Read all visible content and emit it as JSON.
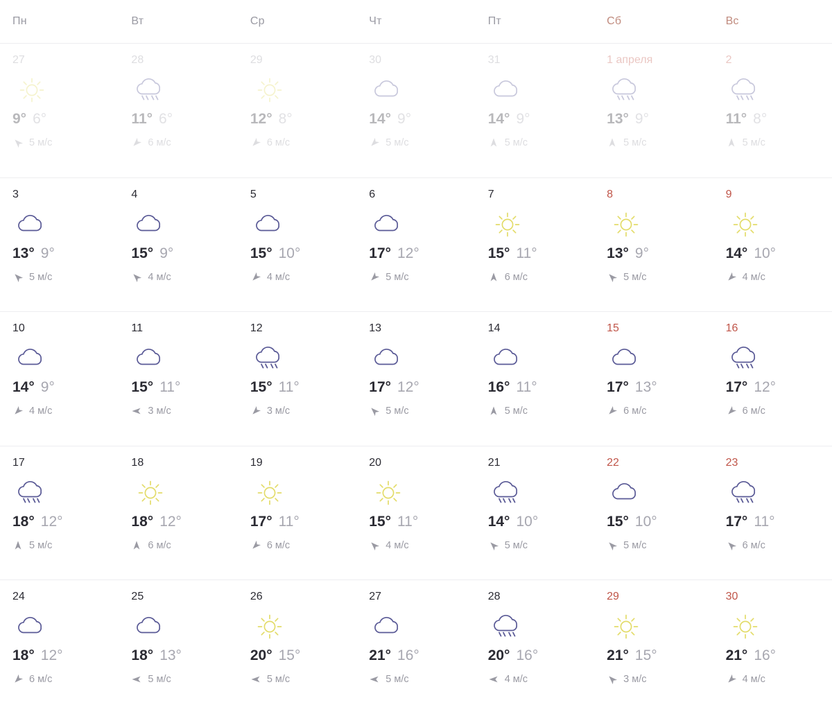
{
  "colors": {
    "sun": "#e3dc6a",
    "cloud": "#5a5a96",
    "rain": "#5a5a96",
    "weekend_header": "#c08b7e",
    "weekend_number": "#c0564a",
    "day_temp": "#2b2b33",
    "night_temp": "#a7a7b0",
    "wind": "#9a9aa3",
    "grid_line": "#ededf0",
    "background": "#ffffff"
  },
  "wind_unit": "м/с",
  "degree": "°",
  "weekdays": [
    {
      "label": "Пн",
      "weekend": false
    },
    {
      "label": "Вт",
      "weekend": false
    },
    {
      "label": "Ср",
      "weekend": false
    },
    {
      "label": "Чт",
      "weekend": false
    },
    {
      "label": "Пт",
      "weekend": false
    },
    {
      "label": "Сб",
      "weekend": true
    },
    {
      "label": "Вс",
      "weekend": true
    }
  ],
  "weeks": [
    {
      "past": true,
      "days": [
        {
          "date": "27",
          "weekend": false,
          "icon": "sun",
          "day_temp": "9°",
          "night_temp": "6°",
          "wind_dir": "nw",
          "wind_speed": "5 м/с"
        },
        {
          "date": "28",
          "weekend": false,
          "icon": "rain",
          "day_temp": "11°",
          "night_temp": "6°",
          "wind_dir": "sw",
          "wind_speed": "6 м/с"
        },
        {
          "date": "29",
          "weekend": false,
          "icon": "sun",
          "day_temp": "12°",
          "night_temp": "8°",
          "wind_dir": "sw",
          "wind_speed": "6 м/с"
        },
        {
          "date": "30",
          "weekend": false,
          "icon": "cloud",
          "day_temp": "14°",
          "night_temp": "9°",
          "wind_dir": "sw",
          "wind_speed": "5 м/с"
        },
        {
          "date": "31",
          "weekend": false,
          "icon": "cloud",
          "day_temp": "14°",
          "night_temp": "9°",
          "wind_dir": "n",
          "wind_speed": "5 м/с"
        },
        {
          "date": "1 апреля",
          "weekend": true,
          "icon": "rain",
          "day_temp": "13°",
          "night_temp": "9°",
          "wind_dir": "n",
          "wind_speed": "5 м/с"
        },
        {
          "date": "2",
          "weekend": true,
          "icon": "rain",
          "day_temp": "11°",
          "night_temp": "8°",
          "wind_dir": "n",
          "wind_speed": "5 м/с"
        }
      ]
    },
    {
      "past": false,
      "days": [
        {
          "date": "3",
          "weekend": false,
          "icon": "cloud",
          "day_temp": "13°",
          "night_temp": "9°",
          "wind_dir": "nw",
          "wind_speed": "5 м/с"
        },
        {
          "date": "4",
          "weekend": false,
          "icon": "cloud",
          "day_temp": "15°",
          "night_temp": "9°",
          "wind_dir": "nw",
          "wind_speed": "4 м/с"
        },
        {
          "date": "5",
          "weekend": false,
          "icon": "cloud",
          "day_temp": "15°",
          "night_temp": "10°",
          "wind_dir": "sw",
          "wind_speed": "4 м/с"
        },
        {
          "date": "6",
          "weekend": false,
          "icon": "cloud",
          "day_temp": "17°",
          "night_temp": "12°",
          "wind_dir": "sw",
          "wind_speed": "5 м/с"
        },
        {
          "date": "7",
          "weekend": false,
          "icon": "sun",
          "day_temp": "15°",
          "night_temp": "11°",
          "wind_dir": "n",
          "wind_speed": "6 м/с"
        },
        {
          "date": "8",
          "weekend": true,
          "icon": "sun",
          "day_temp": "13°",
          "night_temp": "9°",
          "wind_dir": "nw",
          "wind_speed": "5 м/с"
        },
        {
          "date": "9",
          "weekend": true,
          "icon": "sun",
          "day_temp": "14°",
          "night_temp": "10°",
          "wind_dir": "sw",
          "wind_speed": "4 м/с"
        }
      ]
    },
    {
      "past": false,
      "days": [
        {
          "date": "10",
          "weekend": false,
          "icon": "cloud",
          "day_temp": "14°",
          "night_temp": "9°",
          "wind_dir": "sw",
          "wind_speed": "4 м/с"
        },
        {
          "date": "11",
          "weekend": false,
          "icon": "cloud",
          "day_temp": "15°",
          "night_temp": "11°",
          "wind_dir": "w",
          "wind_speed": "3 м/с"
        },
        {
          "date": "12",
          "weekend": false,
          "icon": "rain",
          "day_temp": "15°",
          "night_temp": "11°",
          "wind_dir": "sw",
          "wind_speed": "3 м/с"
        },
        {
          "date": "13",
          "weekend": false,
          "icon": "cloud",
          "day_temp": "17°",
          "night_temp": "12°",
          "wind_dir": "nw",
          "wind_speed": "5 м/с"
        },
        {
          "date": "14",
          "weekend": false,
          "icon": "cloud",
          "day_temp": "16°",
          "night_temp": "11°",
          "wind_dir": "n",
          "wind_speed": "5 м/с"
        },
        {
          "date": "15",
          "weekend": true,
          "icon": "cloud",
          "day_temp": "17°",
          "night_temp": "13°",
          "wind_dir": "sw",
          "wind_speed": "6 м/с"
        },
        {
          "date": "16",
          "weekend": true,
          "icon": "rain",
          "day_temp": "17°",
          "night_temp": "12°",
          "wind_dir": "sw",
          "wind_speed": "6 м/с"
        }
      ]
    },
    {
      "past": false,
      "days": [
        {
          "date": "17",
          "weekend": false,
          "icon": "rain",
          "day_temp": "18°",
          "night_temp": "12°",
          "wind_dir": "n",
          "wind_speed": "5 м/с"
        },
        {
          "date": "18",
          "weekend": false,
          "icon": "sun",
          "day_temp": "18°",
          "night_temp": "12°",
          "wind_dir": "n",
          "wind_speed": "6 м/с"
        },
        {
          "date": "19",
          "weekend": false,
          "icon": "sun",
          "day_temp": "17°",
          "night_temp": "11°",
          "wind_dir": "sw",
          "wind_speed": "6 м/с"
        },
        {
          "date": "20",
          "weekend": false,
          "icon": "sun",
          "day_temp": "15°",
          "night_temp": "11°",
          "wind_dir": "nw",
          "wind_speed": "4 м/с"
        },
        {
          "date": "21",
          "weekend": false,
          "icon": "rain",
          "day_temp": "14°",
          "night_temp": "10°",
          "wind_dir": "nw",
          "wind_speed": "5 м/с"
        },
        {
          "date": "22",
          "weekend": true,
          "icon": "cloud",
          "day_temp": "15°",
          "night_temp": "10°",
          "wind_dir": "nw",
          "wind_speed": "5 м/с"
        },
        {
          "date": "23",
          "weekend": true,
          "icon": "rain",
          "day_temp": "17°",
          "night_temp": "11°",
          "wind_dir": "nw",
          "wind_speed": "6 м/с"
        }
      ]
    },
    {
      "past": false,
      "days": [
        {
          "date": "24",
          "weekend": false,
          "icon": "cloud",
          "day_temp": "18°",
          "night_temp": "12°",
          "wind_dir": "sw",
          "wind_speed": "6 м/с"
        },
        {
          "date": "25",
          "weekend": false,
          "icon": "cloud",
          "day_temp": "18°",
          "night_temp": "13°",
          "wind_dir": "w",
          "wind_speed": "5 м/с"
        },
        {
          "date": "26",
          "weekend": false,
          "icon": "sun",
          "day_temp": "20°",
          "night_temp": "15°",
          "wind_dir": "w",
          "wind_speed": "5 м/с"
        },
        {
          "date": "27",
          "weekend": false,
          "icon": "cloud",
          "day_temp": "21°",
          "night_temp": "16°",
          "wind_dir": "w",
          "wind_speed": "5 м/с"
        },
        {
          "date": "28",
          "weekend": false,
          "icon": "rain",
          "day_temp": "20°",
          "night_temp": "16°",
          "wind_dir": "w",
          "wind_speed": "4 м/с"
        },
        {
          "date": "29",
          "weekend": true,
          "icon": "sun",
          "day_temp": "21°",
          "night_temp": "15°",
          "wind_dir": "nw",
          "wind_speed": "3 м/с"
        },
        {
          "date": "30",
          "weekend": true,
          "icon": "sun",
          "day_temp": "21°",
          "night_temp": "16°",
          "wind_dir": "sw",
          "wind_speed": "4 м/с"
        }
      ]
    }
  ]
}
